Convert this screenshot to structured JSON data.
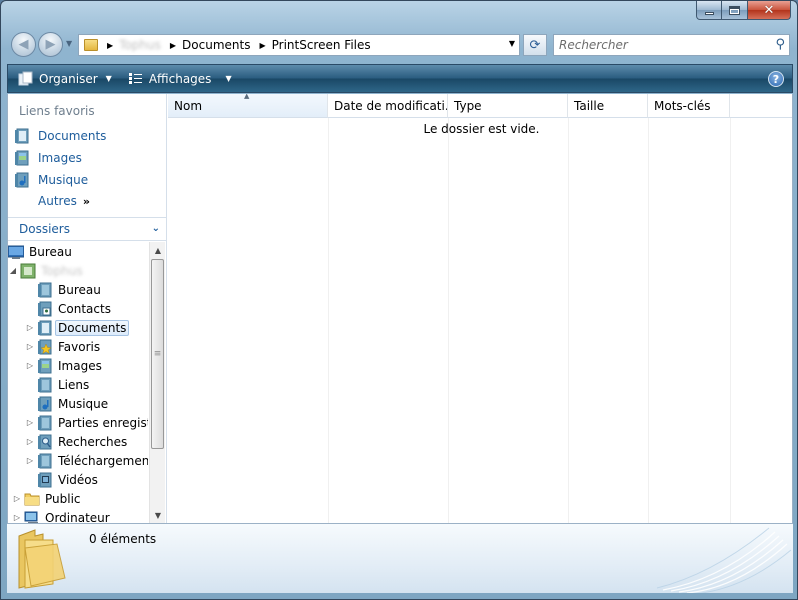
{
  "window": {
    "controls": {
      "minimize": "–",
      "maximize": "□",
      "close": "✕"
    }
  },
  "address_bar": {
    "crumbs": [
      "Tophus",
      "Documents",
      "PrintScreen Files"
    ]
  },
  "search": {
    "placeholder": "Rechercher"
  },
  "command_bar": {
    "organize_label": "Organiser",
    "views_label": "Affichages",
    "help_label": "?"
  },
  "favorites": {
    "title": "Liens favoris",
    "items": [
      {
        "label": "Documents",
        "icon": "documents-icon"
      },
      {
        "label": "Images",
        "icon": "images-icon"
      },
      {
        "label": "Musique",
        "icon": "music-icon"
      }
    ],
    "more_label": "Autres",
    "more_glyph": "»"
  },
  "folders": {
    "title": "Dossiers",
    "tree": [
      {
        "label": "Bureau"
      },
      {
        "label": "Tophus"
      },
      {
        "label": "Bureau"
      },
      {
        "label": "Contacts"
      },
      {
        "label": "Documents"
      },
      {
        "label": "Favoris"
      },
      {
        "label": "Images"
      },
      {
        "label": "Liens"
      },
      {
        "label": "Musique"
      },
      {
        "label": "Parties enregistrées"
      },
      {
        "label": "Recherches"
      },
      {
        "label": "Téléchargement"
      },
      {
        "label": "Vidéos"
      },
      {
        "label": "Public"
      },
      {
        "label": "Ordinateur"
      }
    ]
  },
  "columns": [
    "Nom",
    "Date de modificati...",
    "Type",
    "Taille",
    "Mots-clés"
  ],
  "empty_message": "Le dossier est vide.",
  "details": {
    "count_text": "0 éléments"
  }
}
